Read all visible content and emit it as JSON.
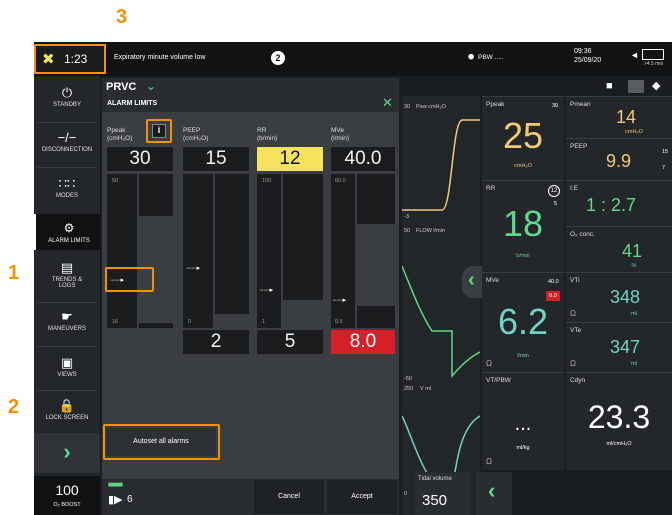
{
  "callouts": {
    "c1": "1",
    "c2": "2",
    "c3": "3"
  },
  "topbar": {
    "timer": "1:23",
    "alarm_message": "Expiratory minute volume low",
    "alarm_count": "2",
    "pbw_label": "PBW .....",
    "time": "09:36",
    "date": "25/09/20",
    "battery_text": ">4.5 min"
  },
  "mode": {
    "label": "PRVC"
  },
  "sidebar": {
    "standby": "STANDBY",
    "disconnection": "DISCONNECTION",
    "modes": "MODES",
    "alarm_limits": "ALARM LIMITS",
    "trends_logs_1": "TRENDS &",
    "trends_logs_2": "LOGS",
    "maneuvers": "MANEUVERS",
    "views": "VIEWS",
    "lock_screen": "LOCK SCREEN",
    "o2_boost_value": "100",
    "o2_boost_label": "O₂ BOOST"
  },
  "alarm_panel": {
    "title": "ALARM LIMITS",
    "info_label": "i",
    "columns": [
      {
        "name": "Ppeak",
        "unit": "(cmH₂O)",
        "upper": "30",
        "scale_top": "50",
        "lower": "",
        "scale_bottom": "16"
      },
      {
        "name": "PEEP",
        "unit": "(cmH₂O)",
        "upper": "15",
        "scale_top": "",
        "lower": "2",
        "scale_bottom": "0"
      },
      {
        "name": "RR",
        "unit": "(b/min)",
        "upper": "12",
        "scale_top": "100",
        "lower": "5",
        "scale_bottom": "1"
      },
      {
        "name": "MVe",
        "unit": "(l/min)",
        "upper": "40.0",
        "scale_top": "60.0",
        "lower": "8.0",
        "scale_bottom": "0.5"
      }
    ],
    "autoset_label": "Autoset all alarms",
    "volume_value": "6",
    "cancel_label": "Cancel",
    "accept_label": "Accept"
  },
  "waveforms": {
    "paw_scale": "30",
    "paw_label": "Paw cmH₂O",
    "paw_neg": "-3",
    "flow_scale": "50",
    "flow_label": "FLOW l/min",
    "flow_neg": "-50",
    "vol_scale": "250",
    "vol_label": "V ml",
    "vol_zero": "0",
    "tidal_label": "Tidal volume",
    "tidal_value": "350"
  },
  "tiles": {
    "ppeak": {
      "label": "Ppeak",
      "max": "30",
      "value": "25",
      "unit": "cmH₂O"
    },
    "pmean": {
      "label": "Pmean",
      "value": "14",
      "unit": "cmH₂O"
    },
    "peep": {
      "label": "PEEP",
      "value": "9.9",
      "max": "15",
      "min": "7"
    },
    "rr": {
      "label": "RR",
      "badge": "12",
      "min": "5",
      "value": "18",
      "unit": "b/min"
    },
    "ie": {
      "label": "I:E",
      "value": "1 : 2.7"
    },
    "o2": {
      "label": "O₂ conc.",
      "value": "41",
      "unit": "%"
    },
    "mve": {
      "label": "MVe",
      "max": "40.0",
      "min": "8.0",
      "value": "6.2",
      "unit": "l/min"
    },
    "vti": {
      "label": "VTi",
      "value": "348",
      "unit": "ml"
    },
    "vte": {
      "label": "VTe",
      "value": "347",
      "unit": "ml"
    },
    "vtpbw": {
      "label": "VT/PBW",
      "value": "...",
      "unit": "ml/kg"
    },
    "cdyn": {
      "label": "Cdyn",
      "value": "23.3",
      "unit": "ml/cmH₂O"
    }
  },
  "colors": {
    "accent": "#f39200",
    "green": "#5fd98a",
    "teal": "#6fd3c8",
    "yellow": "#f5e35e",
    "alarm_red": "#d61f26",
    "gold": "#f2c879"
  }
}
